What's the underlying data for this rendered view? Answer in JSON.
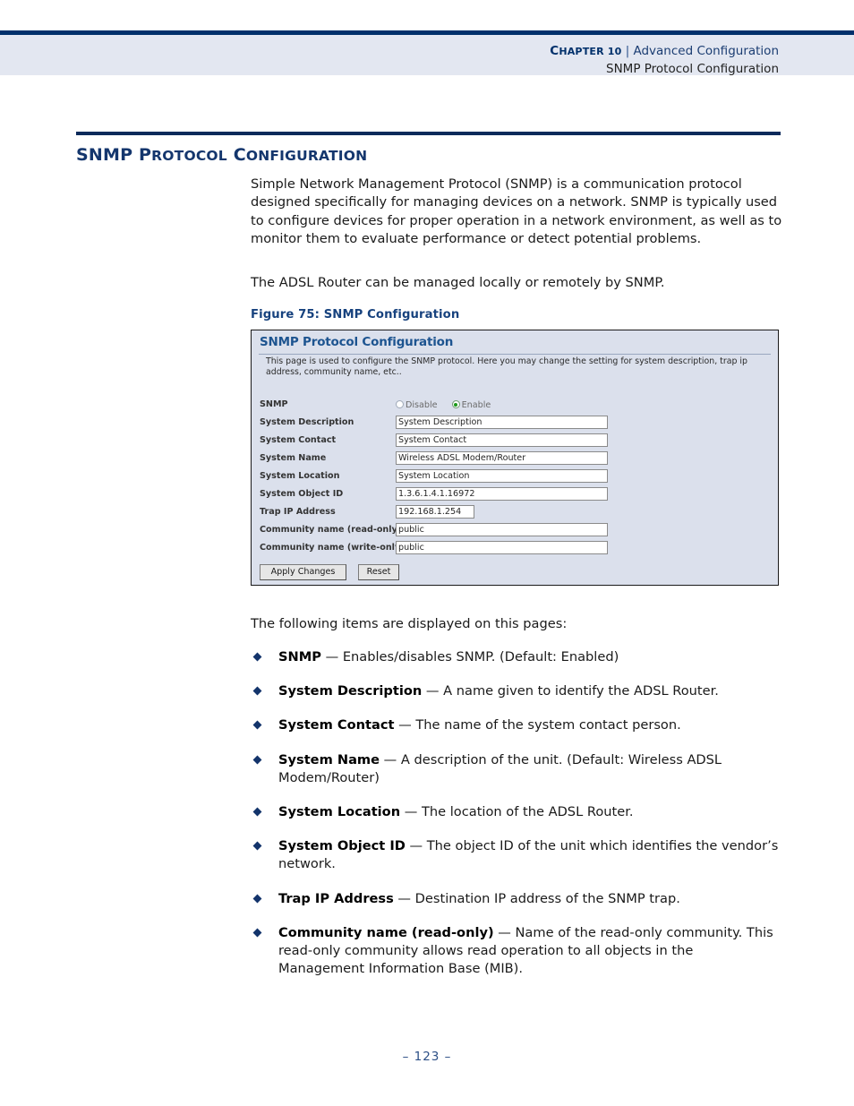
{
  "header": {
    "chapter_label": "Chapter 10",
    "chapter_small_caps": "HAPTER 10",
    "chapter_cap": "C",
    "separator": "|",
    "chapter_title": "Advanced Configuration",
    "section_title": "SNMP Protocol Configuration"
  },
  "section": {
    "heading_cap1": "SNMP P",
    "heading_sc1": "ROTOCOL",
    "heading_cap2": " C",
    "heading_sc2": "ONFIGURATION",
    "heading_plain": "SNMP Protocol Configuration"
  },
  "body": {
    "paragraph1": "Simple Network Management Protocol (SNMP) is a communication protocol designed specifically for managing devices on a network. SNMP is typically used to configure devices for proper operation in a network environment, as well as to monitor them to evaluate performance or detect potential problems.",
    "paragraph2": "The ADSL Router can be managed locally or remotely by SNMP.",
    "lead_in": "The following items are displayed on this pages:"
  },
  "figure": {
    "caption": "Figure 75:  SNMP Configuration",
    "panel": {
      "title": "SNMP Protocol Configuration",
      "description": "This page is used to configure the SNMP protocol. Here you may change the setting for system description, trap ip address, community name, etc..",
      "fields": [
        {
          "label": "SNMP",
          "type": "radio",
          "options": [
            {
              "label": "Disable",
              "selected": false
            },
            {
              "label": "Enable",
              "selected": true
            }
          ]
        },
        {
          "label": "System Description",
          "type": "text",
          "value": "System Description",
          "width": "long"
        },
        {
          "label": "System Contact",
          "type": "text",
          "value": "System Contact",
          "width": "long"
        },
        {
          "label": "System Name",
          "type": "text",
          "value": "Wireless ADSL Modem/Router",
          "width": "long"
        },
        {
          "label": "System Location",
          "type": "text",
          "value": "System Location",
          "width": "long"
        },
        {
          "label": "System Object ID",
          "type": "text",
          "value": "1.3.6.1.4.1.16972",
          "width": "long"
        },
        {
          "label": "Trap IP Address",
          "type": "text",
          "value": "192.168.1.254",
          "width": "short"
        },
        {
          "label": "Community name (read-only)",
          "type": "text",
          "value": "public",
          "width": "long"
        },
        {
          "label": "Community name (write-only)",
          "type": "text",
          "value": "public",
          "width": "long"
        }
      ],
      "buttons": {
        "apply": "Apply Changes",
        "reset": "Reset"
      }
    }
  },
  "items": [
    {
      "term": "SNMP",
      "dash": " — ",
      "text": "Enables/disables SNMP. (Default: Enabled)"
    },
    {
      "term": "System Description",
      "dash": " — ",
      "text": "A name given to identify the ADSL Router."
    },
    {
      "term": "System Contact",
      "dash": " — ",
      "text": "The name of the system contact person."
    },
    {
      "term": "System Name",
      "dash": " — ",
      "text": "A description of the unit. (Default: Wireless ADSL Modem/Router)"
    },
    {
      "term": "System Location",
      "dash": " — ",
      "text": "The location of the ADSL Router."
    },
    {
      "term": "System Object ID",
      "dash": " — ",
      "text": "The object ID of the unit which identifies the vendor’s network."
    },
    {
      "term": "Trap IP Address",
      "dash": " — ",
      "text": "Destination IP address of the SNMP trap."
    },
    {
      "term": "Community name (read-only)",
      "dash": " — ",
      "text": "Name of the read-only community. This read-only community allows read operation to all objects in the Management Information Base (MIB)."
    }
  ],
  "footer": {
    "page_number": "–  123  –"
  },
  "colors": {
    "header_band": "#e3e7f1",
    "navy_rule": "#00306b",
    "heading_blue": "#14366d",
    "caption_blue": "#17427e",
    "panel_bg": "#dbe0ec",
    "panel_title_blue": "#1d5490",
    "bullet_navy": "#13346b",
    "radio_on_green": "#1a9a1a",
    "footer_blue": "#2c4f86"
  }
}
